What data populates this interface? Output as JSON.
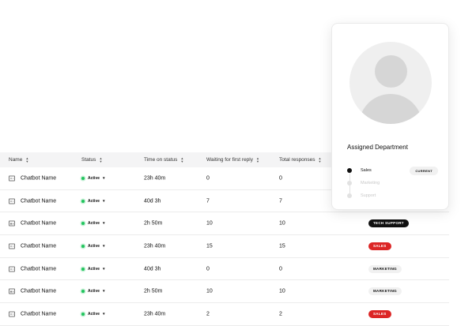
{
  "table": {
    "headers": {
      "name": "Name",
      "status": "Status",
      "time": "Time on status",
      "waiting": "Waiting for first reply",
      "total": "Total responses"
    },
    "rows": [
      {
        "name": "Chatbot Name",
        "status": "Active",
        "time": "23h 40m",
        "waiting": "0",
        "total": "0",
        "department": ""
      },
      {
        "name": "Chatbot Name",
        "status": "Active",
        "time": "40d 3h",
        "waiting": "7",
        "total": "7",
        "department": ""
      },
      {
        "name": "Chatbot Name",
        "status": "Active",
        "time": "2h 50m",
        "waiting": "10",
        "total": "10",
        "department": "TECH SUPPORT"
      },
      {
        "name": "Chatbot Name",
        "status": "Active",
        "time": "23h 40m",
        "waiting": "15",
        "total": "15",
        "department": "SALES"
      },
      {
        "name": "Chatbot Name",
        "status": "Active",
        "time": "40d 3h",
        "waiting": "0",
        "total": "0",
        "department": "MARKETING"
      },
      {
        "name": "Chatbot Name",
        "status": "Active",
        "time": "2h 50m",
        "waiting": "10",
        "total": "10",
        "department": "MARKETING"
      },
      {
        "name": "Chatbot Name",
        "status": "Active",
        "time": "23h 40m",
        "waiting": "2",
        "total": "2",
        "department": "SALES"
      }
    ]
  },
  "card": {
    "title": "Assigned Department",
    "timeline": [
      {
        "label": "Sales",
        "active": true,
        "badge": "CURRENT"
      },
      {
        "label": "Marketing",
        "active": false,
        "badge": ""
      },
      {
        "label": "Support",
        "active": false,
        "badge": ""
      }
    ]
  },
  "colors": {
    "status_active": "#22c55e",
    "pill_dark": "#111111",
    "pill_red": "#dc2626",
    "pill_light": "#f1f1f1"
  },
  "icons": {
    "row_icon": "chatbot-icon",
    "sort_icon": "sort-icon",
    "status_dot": "status-dot-icon",
    "caret": "chevron-down-icon"
  }
}
